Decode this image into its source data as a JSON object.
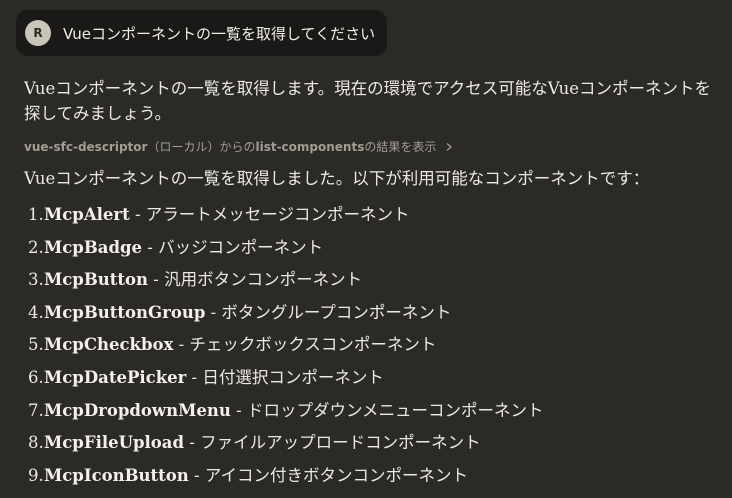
{
  "user_message": {
    "avatar_initial": "R",
    "text": "Vueコンポーネントの一覧を取得してください"
  },
  "assistant": {
    "intro": "Vueコンポーネントの一覧を取得します。現在の環境でアクセス可能なVueコンポーネントを探してみましょう。",
    "tool_call": {
      "server": "vue-sfc-descriptor",
      "server_suffix": "（ローカル）からの",
      "tool": "list-components",
      "tool_suffix": "の結果を表示",
      "chevron_icon": "chevron-right-icon"
    },
    "summary": "Vueコンポーネントの一覧を取得しました。以下が利用可能なコンポーネントです：",
    "components": [
      {
        "num": "1.",
        "name": "McpAlert",
        "desc": " - アラートメッセージコンポーネント"
      },
      {
        "num": "2.",
        "name": "McpBadge",
        "desc": " - バッジコンポーネント"
      },
      {
        "num": "3.",
        "name": "McpButton",
        "desc": " - 汎用ボタンコンポーネント"
      },
      {
        "num": "4.",
        "name": "McpButtonGroup",
        "desc": " - ボタングループコンポーネント"
      },
      {
        "num": "5.",
        "name": "McpCheckbox",
        "desc": " - チェックボックスコンポーネント"
      },
      {
        "num": "6.",
        "name": "McpDatePicker",
        "desc": " - 日付選択コンポーネント"
      },
      {
        "num": "7.",
        "name": "McpDropdownMenu",
        "desc": " - ドロップダウンメニューコンポーネント"
      },
      {
        "num": "8.",
        "name": "McpFileUpload",
        "desc": " - ファイルアップロードコンポーネント"
      },
      {
        "num": "9.",
        "name": "McpIconButton",
        "desc": " - アイコン付きボタンコンポーネント"
      }
    ]
  }
}
